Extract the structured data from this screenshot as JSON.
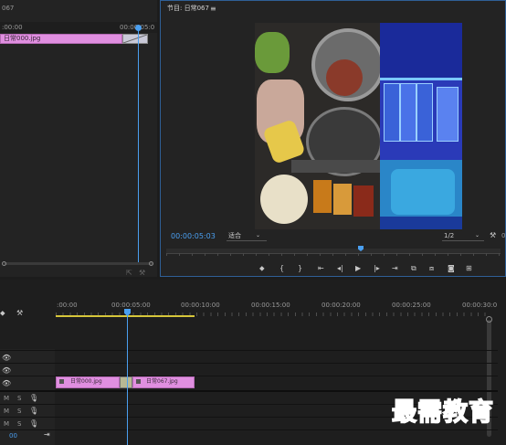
{
  "source_monitor": {
    "title_fragment": "067",
    "ruler_start": ":00:00",
    "ruler_end": "00:00:05:0",
    "clip_label": "日常000.jpg"
  },
  "program_monitor": {
    "title": "节目: 日常067",
    "menu_icon": "hamburger-icon",
    "timecode": "00:00:05:03",
    "fit_label": "适合",
    "resolution_label": "1/2",
    "right_fragment": "0"
  },
  "transport": [
    "marker-icon",
    "in-point-icon",
    "out-point-icon",
    "go-to-in-icon",
    "step-back-icon",
    "play-icon",
    "step-forward-icon",
    "go-to-out-icon",
    "insert-icon",
    "overwrite-icon",
    "export-frame-icon",
    "settings-icon"
  ],
  "timeline": {
    "ruler_labels": [
      ":00:00",
      "00:00:05:00",
      "00:00:10:00",
      "00:00:15:00",
      "00:00:20:00",
      "00:00:25:00",
      "00:00:30:0"
    ],
    "track_labels": {
      "m": "M",
      "s": "S"
    },
    "timecode_fragment": "00",
    "clips": [
      {
        "label": "日常000.jpg"
      },
      {
        "label": "日常067.jpg"
      }
    ]
  },
  "watermark": "最需教育",
  "colors": {
    "clip": "#e08fe0",
    "accent": "#4a9ff0",
    "work_area": "#d6c63a"
  }
}
